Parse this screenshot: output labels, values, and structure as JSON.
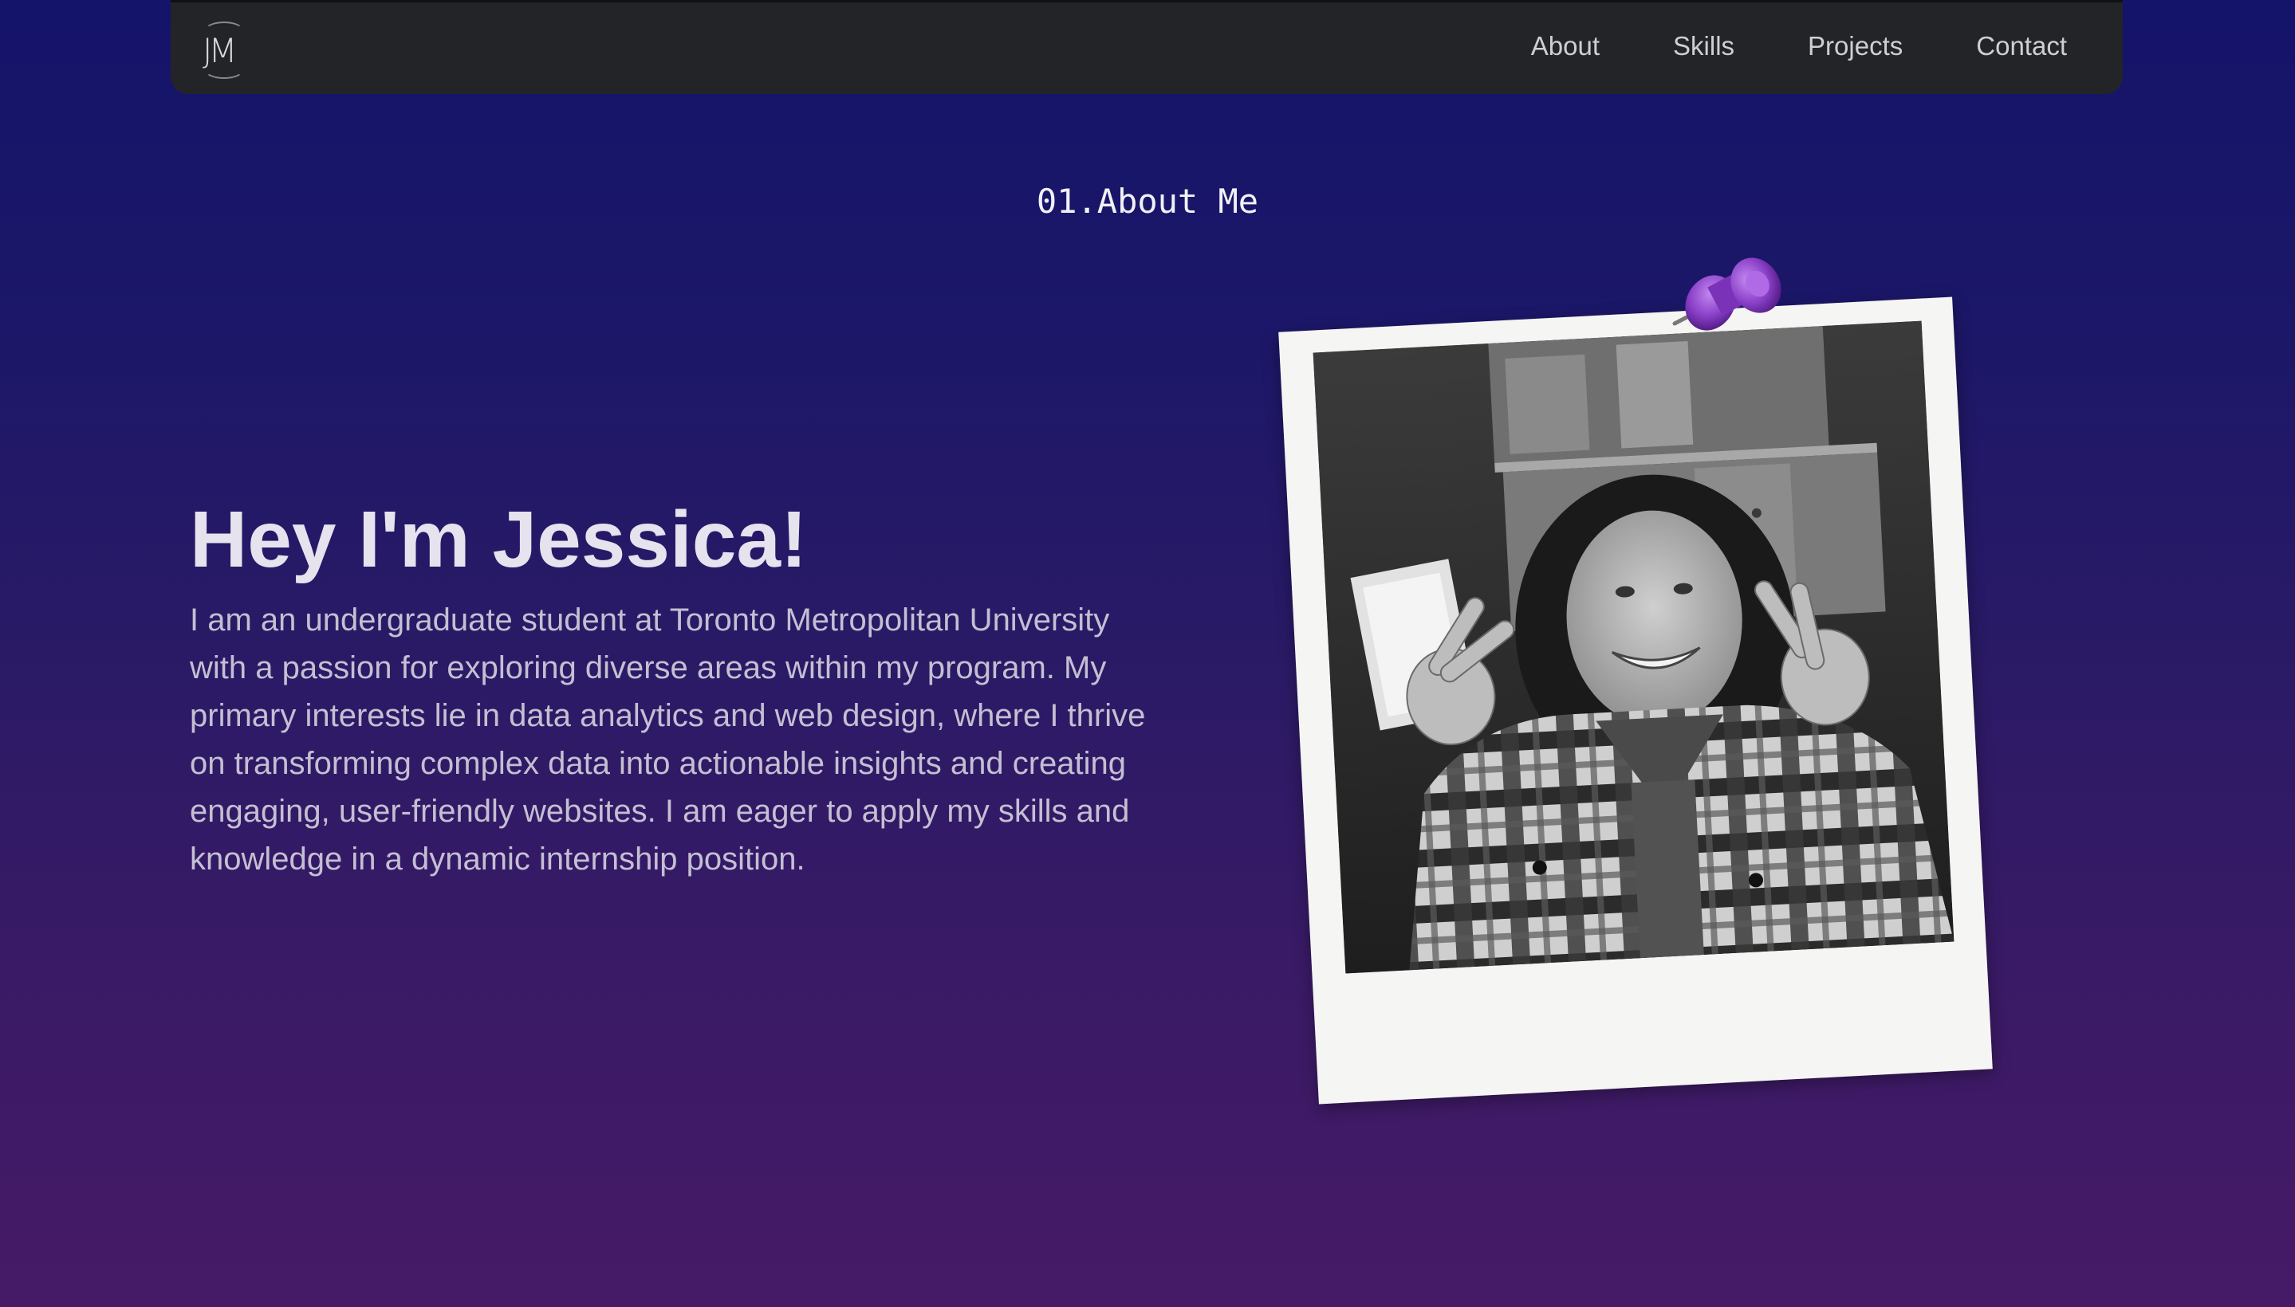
{
  "nav": {
    "logo": "JM",
    "links": [
      "About",
      "Skills",
      "Projects",
      "Contact"
    ]
  },
  "section": {
    "label": "01.About Me"
  },
  "hero": {
    "title": "Hey I'm Jessica!",
    "text": "I am an undergraduate student at Toronto Metropolitan University with a passion for exploring diverse areas within my program. My primary interests lie in data analytics and web design, where I thrive on transforming complex data into actionable insights and creating engaging, user-friendly websites. I am eager to apply my skills and knowledge in a dynamic internship position."
  },
  "colors": {
    "navbar": "#222427",
    "pin": "#8a3fc8",
    "bg_top": "#14146a",
    "bg_bottom": "#461a66"
  },
  "icons": {
    "pin": "push-pin-icon"
  }
}
